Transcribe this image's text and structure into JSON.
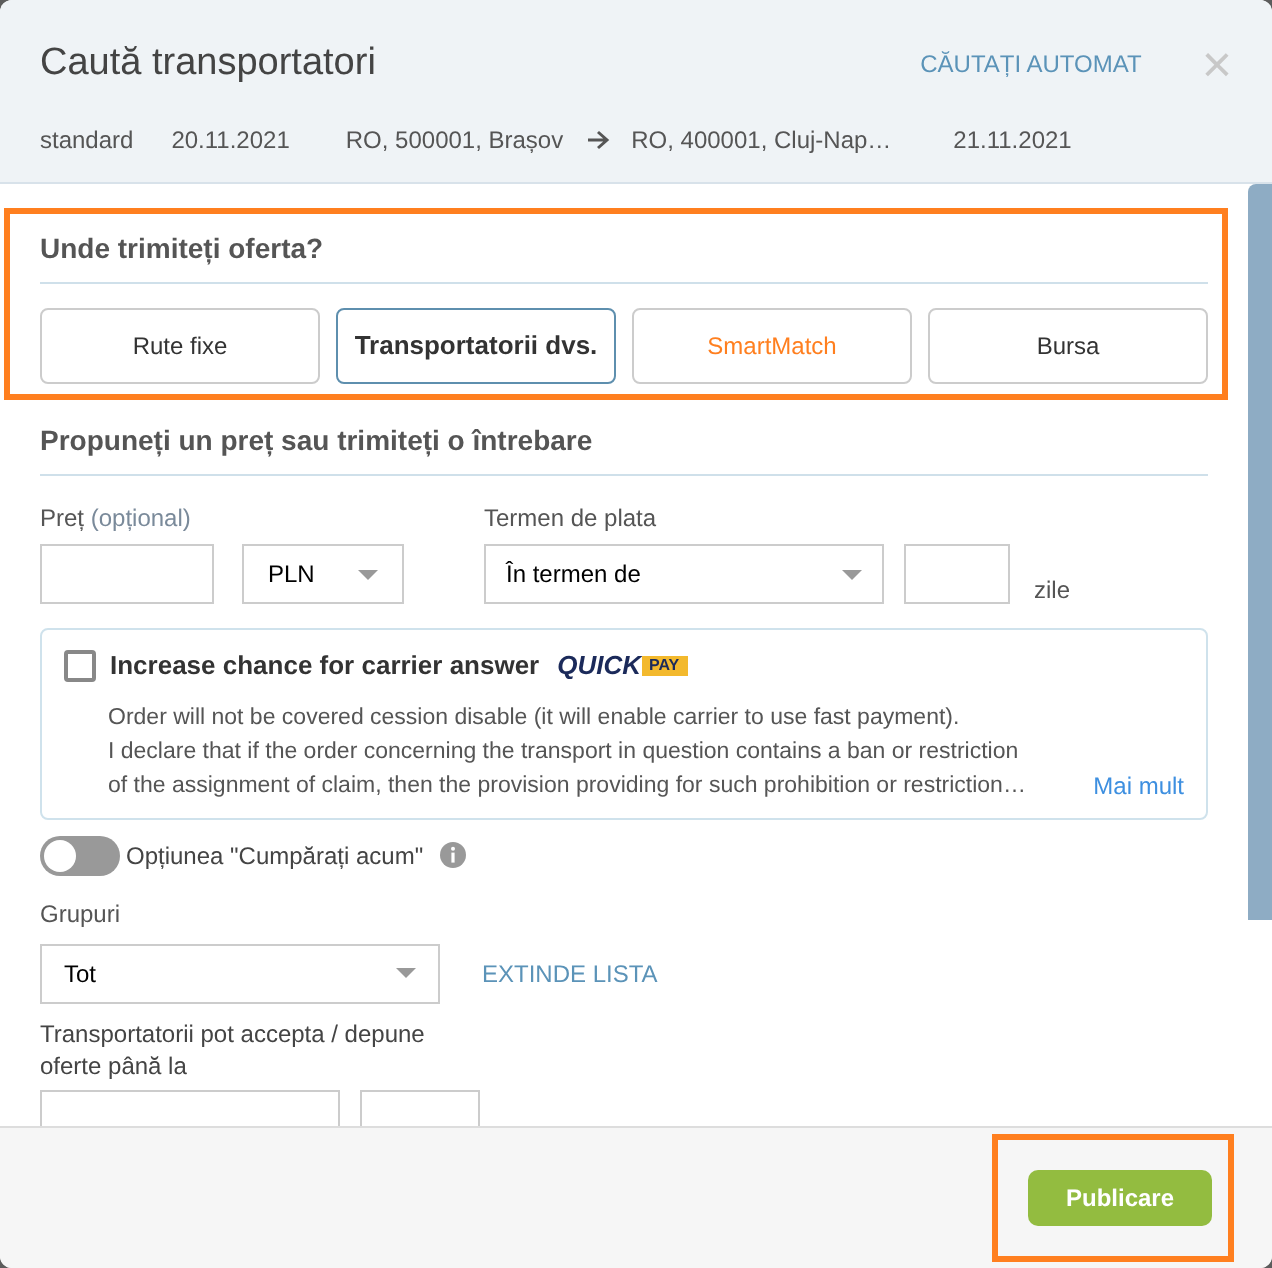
{
  "dialog": {
    "title": "Caută transportatori",
    "auto_search": "CĂUTAȚI AUTOMAT",
    "close": "×"
  },
  "summary": [
    "standard",
    "20.11.2021",
    "RO, 500001, Brașov",
    "RO, 400001, Cluj-Nap…",
    "21.11.2021"
  ],
  "destination": {
    "heading": "Unde trimiteți oferta?",
    "highlighted": true,
    "tabs": [
      {
        "label": "Rute fixe",
        "selected": false,
        "kind": "plain"
      },
      {
        "label": "Transportatorii dvs.",
        "selected": true,
        "kind": "plain"
      },
      {
        "label": "SmartMatch",
        "selected": false,
        "kind": "accent"
      },
      {
        "label": "Bursa",
        "selected": false,
        "kind": "plain"
      }
    ]
  },
  "offer": {
    "heading": "Propuneți un preț sau trimiteți o întrebare",
    "price_label": "Preț",
    "price_hint": "(opțional)",
    "currency": "PLN",
    "term_label": "Termen de plata",
    "term": "În termen de",
    "days_unit": "zile"
  },
  "quickpay": {
    "checked": false,
    "label": "Increase chance for carrier answer",
    "logo_left": "QUICK",
    "logo_right": "PAY",
    "lines": [
      "Order will not be covered cession disable (it will enable carrier to use fast payment).",
      "I declare that if the order concerning the transport in question contains a ban or restriction",
      "of the assignment of claim, then the provision providing for such prohibition or restriction…"
    ],
    "more": "Mai mult"
  },
  "buy_now": {
    "on": false,
    "label": "Opțiunea \"Cumpărați acum\""
  },
  "groups": {
    "label": "Grupuri",
    "value": "Tot",
    "expand": "EXTINDE LISTA"
  },
  "deadline": {
    "label": "Transportatorii pot accepta / depune oferte până la"
  },
  "footer": {
    "publish": "Publicare",
    "highlighted": true
  }
}
